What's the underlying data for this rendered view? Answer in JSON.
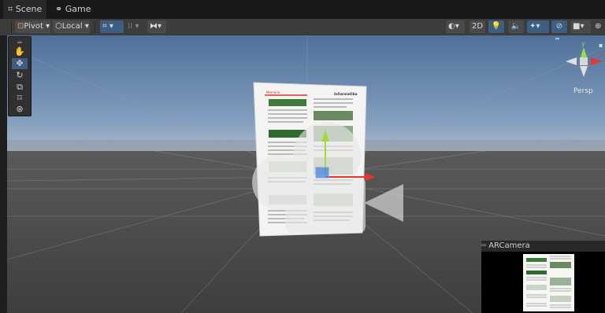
{
  "tabs": [
    {
      "label": "Scene",
      "icon": "grid-icon",
      "active": true
    },
    {
      "label": "Game",
      "icon": "gamepad-icon",
      "active": false
    }
  ],
  "toolbar": {
    "pivot_label": "Pivot",
    "local_label": "Local",
    "mode_2d_label": "2D"
  },
  "gizmo": {
    "projection_label": "Persp",
    "axes": [
      "y",
      "x",
      "z"
    ]
  },
  "ar_camera": {
    "title": "ARCamera"
  },
  "document": {
    "header_label": "Informatika",
    "section_label": "Memória"
  },
  "colors": {
    "toolbar_bg": "#3c3c3c",
    "accent": "#3d5e80",
    "axis_x": "#e8362d",
    "axis_y": "#9fdc3a",
    "axis_z": "#3d7fe0",
    "sky": "#6a8bb0",
    "ground": "#4a4a4a"
  }
}
